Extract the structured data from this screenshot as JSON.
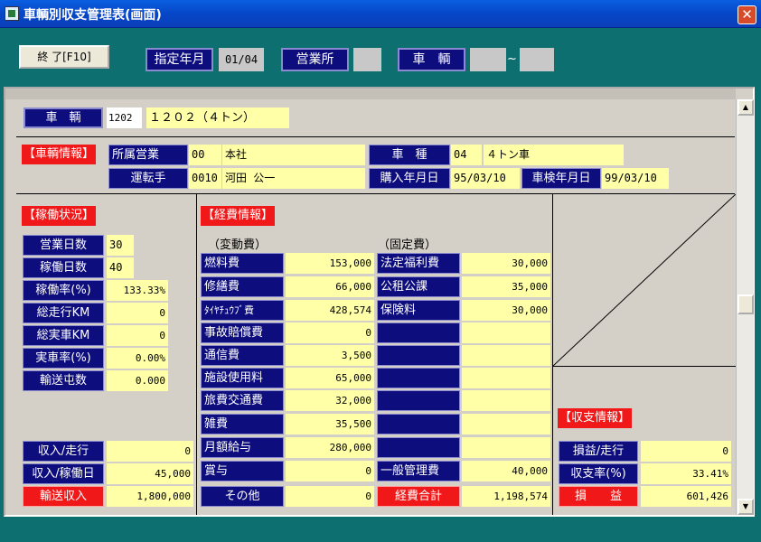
{
  "window": {
    "title": "車輌別収支管理表(画面)"
  },
  "toolbar": {
    "end_label": "終 了[F10]",
    "month_label": "指定年月",
    "month_value": "01/04",
    "office_label": "営業所",
    "office_value": "",
    "vehicle_label": "車　輌",
    "vehicle_from": "",
    "range_sep": "~",
    "vehicle_to": ""
  },
  "vehicle": {
    "label": "車　輌",
    "code": "1202",
    "name": "１２０２（４トン）"
  },
  "vehicle_info": {
    "header": "【車輌情報】",
    "office_label": "所属営業",
    "office_code": "00",
    "office_name": "本社",
    "driver_label": "運転手",
    "driver_code": "0010",
    "driver_name": "河田 公一",
    "type_label": "車　種",
    "type_code": "04",
    "type_name": "４トン車",
    "purchase_label": "購入年月日",
    "purchase_date": "95/03/10",
    "inspect_label": "車検年月日",
    "inspect_date": "99/03/10"
  },
  "operation": {
    "header": "【稼働状況】",
    "rows": [
      {
        "label": "営業日数",
        "value": "30"
      },
      {
        "label": "稼働日数",
        "value": "40"
      },
      {
        "label": "稼働率(%)",
        "value": "133.33%"
      },
      {
        "label": "総走行KM",
        "value": "0"
      },
      {
        "label": "総実車KM",
        "value": "0"
      },
      {
        "label": "実車率(%)",
        "value": "0.00%"
      },
      {
        "label": "輸送屯数",
        "value": "0.000"
      }
    ],
    "bottom": [
      {
        "label": "収入/走行",
        "value": "0"
      },
      {
        "label": "収入/稼働日",
        "value": "45,000"
      },
      {
        "label": "輸送収入",
        "value": "1,800,000"
      }
    ]
  },
  "expense": {
    "header": "【経費情報】",
    "variable_label": "（変動費）",
    "fixed_label": "（固定費）",
    "variable": [
      {
        "label": "燃料費",
        "value": "153,000"
      },
      {
        "label": "修繕費",
        "value": "66,000"
      },
      {
        "label": "ﾀｲﾔﾁｭｳﾌﾞ費",
        "value": "428,574"
      },
      {
        "label": "事故賠償費",
        "value": "0"
      },
      {
        "label": "通信費",
        "value": "3,500"
      },
      {
        "label": "施設使用料",
        "value": "65,000"
      },
      {
        "label": "旅費交通費",
        "value": "32,000"
      },
      {
        "label": "雑費",
        "value": "35,500"
      },
      {
        "label": "月額給与",
        "value": "280,000"
      },
      {
        "label": "賞与",
        "value": "0"
      },
      {
        "label": "その他",
        "value": "0"
      }
    ],
    "fixed": [
      {
        "label": "法定福利費",
        "value": "30,000"
      },
      {
        "label": "公租公課",
        "value": "35,000"
      },
      {
        "label": "保険料",
        "value": "30,000"
      },
      {
        "label": "",
        "value": ""
      },
      {
        "label": "",
        "value": ""
      },
      {
        "label": "",
        "value": ""
      },
      {
        "label": "",
        "value": ""
      },
      {
        "label": "",
        "value": ""
      },
      {
        "label": "",
        "value": ""
      },
      {
        "label": "一般管理費",
        "value": "40,000"
      },
      {
        "label": "経費合計",
        "value": "1,198,574"
      }
    ]
  },
  "balance": {
    "header": "【収支情報】",
    "rows": [
      {
        "label": "損益/走行",
        "value": "0"
      },
      {
        "label": "収支率(%)",
        "value": "33.41%"
      },
      {
        "label": "損　　益",
        "value": "601,426"
      }
    ]
  },
  "colors": {
    "navy": "#0d0d7e",
    "yellow": "#ffffa8",
    "red": "#f01818",
    "teal": "#0d6f6f",
    "panel": "#d4d0c8"
  }
}
